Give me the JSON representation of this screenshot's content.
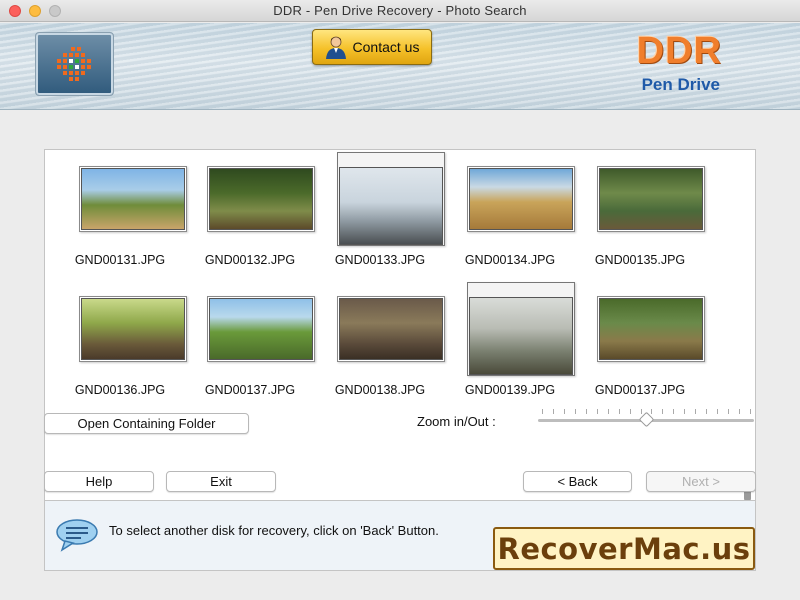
{
  "window": {
    "title": "DDR - Pen Drive Recovery - Photo Search"
  },
  "header": {
    "contact_label": "Contact us",
    "brand_title": "DDR",
    "brand_subtitle": "Pen Drive"
  },
  "gallery": {
    "items": [
      {
        "label": "GND00131.JPG",
        "selected": false
      },
      {
        "label": "GND00132.JPG",
        "selected": false
      },
      {
        "label": "GND00133.JPG",
        "selected": true
      },
      {
        "label": "GND00134.JPG",
        "selected": false
      },
      {
        "label": "GND00135.JPG",
        "selected": false
      },
      {
        "label": "GND00136.JPG",
        "selected": false
      },
      {
        "label": "GND00137.JPG",
        "selected": false
      },
      {
        "label": "GND00138.JPG",
        "selected": false
      },
      {
        "label": "GND00139.JPG",
        "selected": true
      },
      {
        "label": "GND00137.JPG",
        "selected": false
      }
    ]
  },
  "controls": {
    "open_folder_label": "Open Containing Folder",
    "zoom_label": "Zoom in/Out :",
    "zoom_level": 0.5
  },
  "nav": {
    "help_label": "Help",
    "exit_label": "Exit",
    "back_label": "< Back",
    "next_label": "Next >"
  },
  "info": {
    "message": "To select another disk for recovery, click on 'Back' Button."
  },
  "watermark": {
    "text": "RecoverMac.us"
  },
  "colors": {
    "accent_orange": "#f07e2c",
    "brand_blue": "#1f5aa8",
    "contact_gold": "#f5c12a"
  }
}
